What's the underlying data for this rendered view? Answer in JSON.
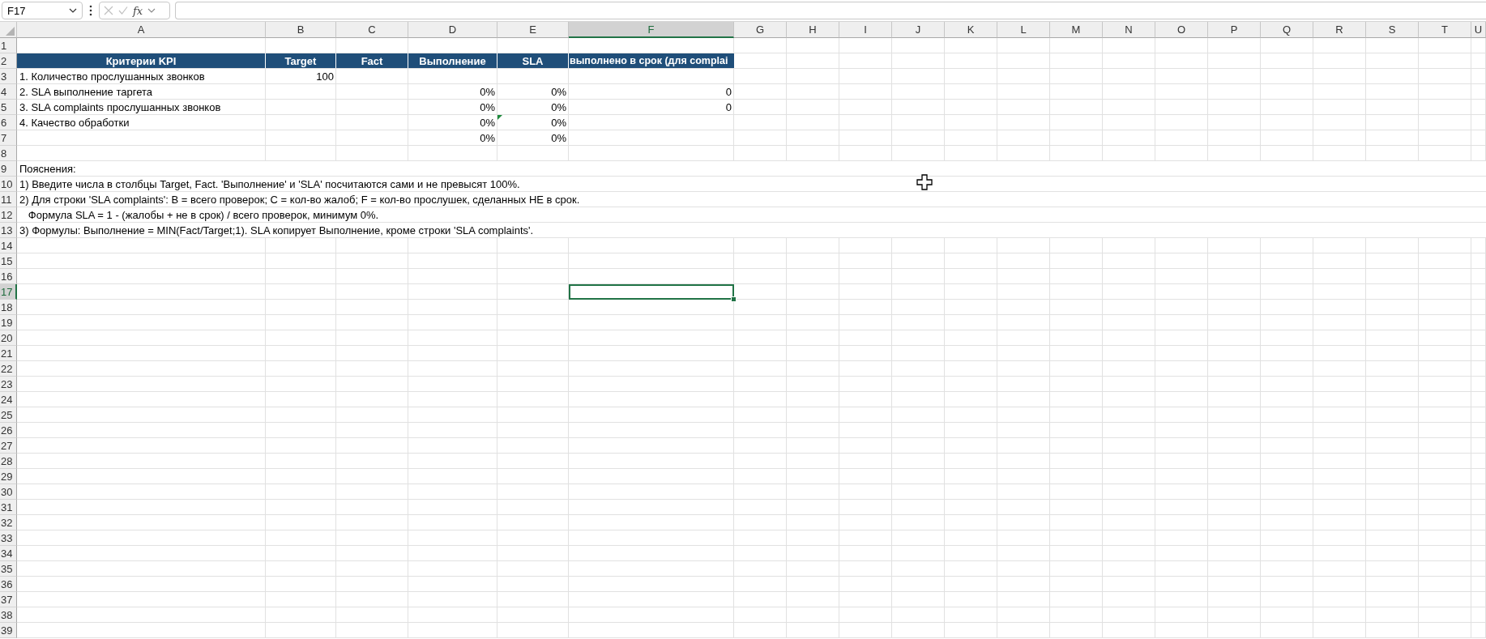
{
  "formula_bar": {
    "name_box": "F17",
    "function_label": "fx"
  },
  "sheet": {
    "columns": [
      {
        "label": "A",
        "selected": false
      },
      {
        "label": "B",
        "selected": false
      },
      {
        "label": "C",
        "selected": false
      },
      {
        "label": "D",
        "selected": false
      },
      {
        "label": "E",
        "selected": false
      },
      {
        "label": "F",
        "selected": true
      },
      {
        "label": "G",
        "selected": false
      },
      {
        "label": "H",
        "selected": false
      },
      {
        "label": "I",
        "selected": false
      },
      {
        "label": "J",
        "selected": false
      },
      {
        "label": "K",
        "selected": false
      },
      {
        "label": "L",
        "selected": false
      },
      {
        "label": "M",
        "selected": false
      },
      {
        "label": "N",
        "selected": false
      },
      {
        "label": "O",
        "selected": false
      },
      {
        "label": "P",
        "selected": false
      },
      {
        "label": "Q",
        "selected": false
      },
      {
        "label": "R",
        "selected": false
      },
      {
        "label": "S",
        "selected": false
      },
      {
        "label": "T",
        "selected": false
      },
      {
        "label": "U",
        "selected": false
      }
    ],
    "rows": [
      {
        "label": "1",
        "selected": false,
        "kind": "blank"
      },
      {
        "label": "2",
        "selected": false,
        "kind": "header",
        "cells": {
          "a": {
            "text": "Критерии KPI",
            "flagged": false
          },
          "b": {
            "text": "Target",
            "flagged": false
          },
          "c": {
            "text": "Fact",
            "flagged": false
          },
          "d": {
            "text": "Выполнение",
            "flagged": false
          },
          "e": {
            "text": "SLA",
            "flagged": false
          },
          "f": {
            "text": "выполнено в срок (для complai",
            "flagged": false
          }
        }
      },
      {
        "label": "3",
        "selected": false,
        "kind": "data",
        "cells": {
          "a": {
            "text": "1. Количество прослушанных звонков",
            "flagged": false
          },
          "b": {
            "text": "100",
            "flagged": false
          }
        }
      },
      {
        "label": "4",
        "selected": false,
        "kind": "data",
        "cells": {
          "a": {
            "text": "2. SLA выполнение таргета",
            "flagged": false
          },
          "d": {
            "text": "0%",
            "flagged": false
          },
          "e": {
            "text": "0%",
            "flagged": false
          },
          "f": {
            "text": "0",
            "flagged": false
          }
        }
      },
      {
        "label": "5",
        "selected": false,
        "kind": "data",
        "cells": {
          "a": {
            "text": "3. SLA complaints прослушанных звонков",
            "flagged": false
          },
          "d": {
            "text": "0%",
            "flagged": false
          },
          "e": {
            "text": "0%",
            "flagged": false
          },
          "f": {
            "text": "0",
            "flagged": false
          }
        }
      },
      {
        "label": "6",
        "selected": false,
        "kind": "data",
        "cells": {
          "a": {
            "text": "4. Качество обработки",
            "flagged": false
          },
          "d": {
            "text": "0%",
            "flagged": false
          },
          "e": {
            "text": "0%",
            "flagged": true
          }
        }
      },
      {
        "label": "7",
        "selected": false,
        "kind": "data",
        "cells": {
          "d": {
            "text": "0%",
            "flagged": false
          },
          "e": {
            "text": "0%",
            "flagged": false
          }
        }
      },
      {
        "label": "8",
        "selected": false,
        "kind": "blank"
      },
      {
        "label": "9",
        "selected": false,
        "kind": "note",
        "cells": {
          "a": {
            "text": "Пояснения:",
            "flagged": false
          }
        }
      },
      {
        "label": "10",
        "selected": false,
        "kind": "note",
        "cells": {
          "a": {
            "text": "1) Введите числа в столбцы Target, Fact. 'Выполнение' и 'SLA' посчитаются сами и не превысят 100%.",
            "flagged": false
          }
        }
      },
      {
        "label": "11",
        "selected": false,
        "kind": "note",
        "cells": {
          "a": {
            "text": "2) Для строки 'SLA complaints': B = всего проверок; C = кол-во жалоб; F = кол-во прослушек, сделанных НЕ в срок.",
            "flagged": false
          }
        }
      },
      {
        "label": "12",
        "selected": false,
        "kind": "note",
        "cells": {
          "a": {
            "text": "   Формула SLA = 1 - (жалобы + не в срок) / всего проверок, минимум 0%.",
            "flagged": false
          }
        }
      },
      {
        "label": "13",
        "selected": false,
        "kind": "note",
        "cells": {
          "a": {
            "text": "3) Формулы: Выполнение = MIN(Fact/Target;1). SLA копирует Выполнение, кроме строки 'SLA complaints'.",
            "flagged": false
          }
        }
      },
      {
        "label": "14",
        "selected": false,
        "kind": "blank"
      },
      {
        "label": "15",
        "selected": false,
        "kind": "blank"
      },
      {
        "label": "16",
        "selected": false,
        "kind": "blank"
      },
      {
        "label": "17",
        "selected": true,
        "kind": "blank"
      },
      {
        "label": "18",
        "selected": false,
        "kind": "blank"
      },
      {
        "label": "19",
        "selected": false,
        "kind": "blank"
      },
      {
        "label": "20",
        "selected": false,
        "kind": "blank"
      },
      {
        "label": "21",
        "selected": false,
        "kind": "blank"
      },
      {
        "label": "22",
        "selected": false,
        "kind": "blank"
      },
      {
        "label": "23",
        "selected": false,
        "kind": "blank"
      },
      {
        "label": "24",
        "selected": false,
        "kind": "blank"
      },
      {
        "label": "25",
        "selected": false,
        "kind": "blank"
      },
      {
        "label": "26",
        "selected": false,
        "kind": "blank"
      },
      {
        "label": "27",
        "selected": false,
        "kind": "blank"
      },
      {
        "label": "28",
        "selected": false,
        "kind": "blank"
      },
      {
        "label": "29",
        "selected": false,
        "kind": "blank"
      },
      {
        "label": "30",
        "selected": false,
        "kind": "blank"
      },
      {
        "label": "31",
        "selected": false,
        "kind": "blank"
      },
      {
        "label": "32",
        "selected": false,
        "kind": "blank"
      },
      {
        "label": "33",
        "selected": false,
        "kind": "blank"
      },
      {
        "label": "34",
        "selected": false,
        "kind": "blank"
      },
      {
        "label": "35",
        "selected": false,
        "kind": "blank"
      },
      {
        "label": "36",
        "selected": false,
        "kind": "blank"
      },
      {
        "label": "37",
        "selected": false,
        "kind": "blank"
      },
      {
        "label": "38",
        "selected": false,
        "kind": "blank"
      },
      {
        "label": "39",
        "selected": false,
        "kind": "blank"
      }
    ]
  }
}
